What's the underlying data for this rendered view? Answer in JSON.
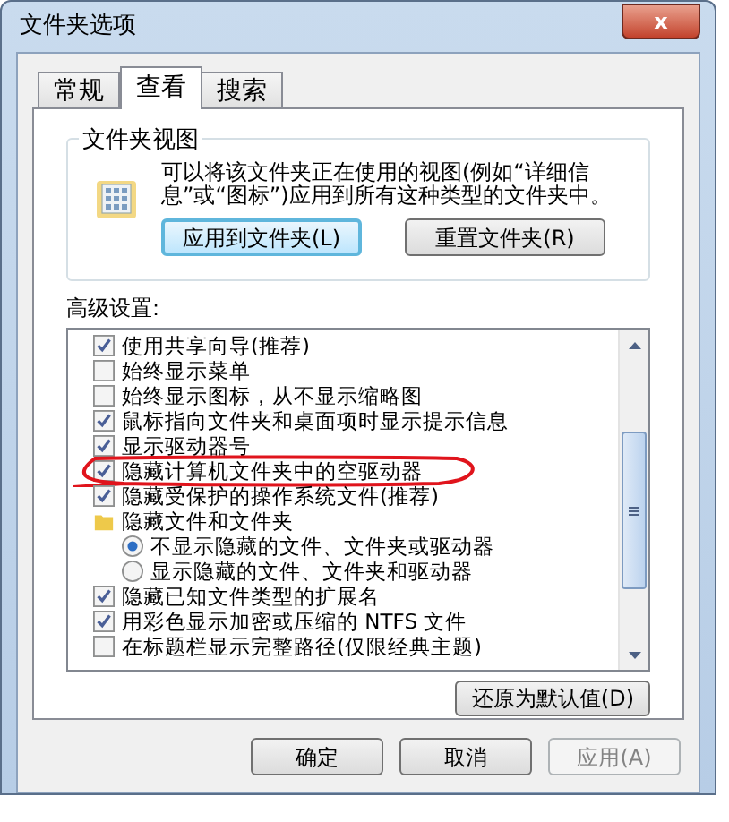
{
  "window": {
    "title": "文件夹选项",
    "close": "x"
  },
  "tabs": [
    {
      "label": "常规",
      "selected": false
    },
    {
      "label": "查看",
      "selected": true
    },
    {
      "label": "搜索",
      "selected": false
    }
  ],
  "folder_views": {
    "title": "文件夹视图",
    "description": "可以将该文件夹正在使用的视图(例如“详细信息”或“图标”)应用到所有这种类型的文件夹中。",
    "buttons": [
      {
        "label": "应用到文件夹(L)",
        "focused": true
      },
      {
        "label": "重置文件夹(R)",
        "focused": false
      }
    ]
  },
  "advanced": {
    "label": "高级设置:",
    "items": [
      {
        "kind": "checkbox",
        "label": "使用共享向导(推荐)",
        "checked": true
      },
      {
        "kind": "checkbox",
        "label": "始终显示菜单",
        "checked": false
      },
      {
        "kind": "checkbox",
        "label": "始终显示图标，从不显示缩略图",
        "checked": false
      },
      {
        "kind": "checkbox",
        "label": "鼠标指向文件夹和桌面项时显示提示信息",
        "checked": true
      },
      {
        "kind": "checkbox",
        "label": "显示驱动器号",
        "checked": true
      },
      {
        "kind": "checkbox",
        "label": "隐藏计算机文件夹中的空驱动器",
        "checked": true,
        "circled": true
      },
      {
        "kind": "checkbox",
        "label": "隐藏受保护的操作系统文件(推荐)",
        "checked": true
      },
      {
        "kind": "folder",
        "label": "隐藏文件和文件夹",
        "children": [
          {
            "kind": "radio",
            "label": "不显示隐藏的文件、文件夹或驱动器",
            "selected": true
          },
          {
            "kind": "radio",
            "label": "显示隐藏的文件、文件夹和驱动器",
            "selected": false
          }
        ]
      },
      {
        "kind": "checkbox",
        "label": "隐藏已知文件类型的扩展名",
        "checked": true
      },
      {
        "kind": "checkbox",
        "label": "用彩色显示加密或压缩的 NTFS 文件",
        "checked": true
      },
      {
        "kind": "checkbox",
        "label": "在标题栏显示完整路径(仅限经典主题)",
        "checked": false
      }
    ],
    "restore_button": "还原为默认值(D)"
  },
  "buttons": [
    {
      "label": "确定",
      "disabled": false
    },
    {
      "label": "取消",
      "disabled": false
    },
    {
      "label": "应用(A)",
      "disabled": true
    }
  ]
}
